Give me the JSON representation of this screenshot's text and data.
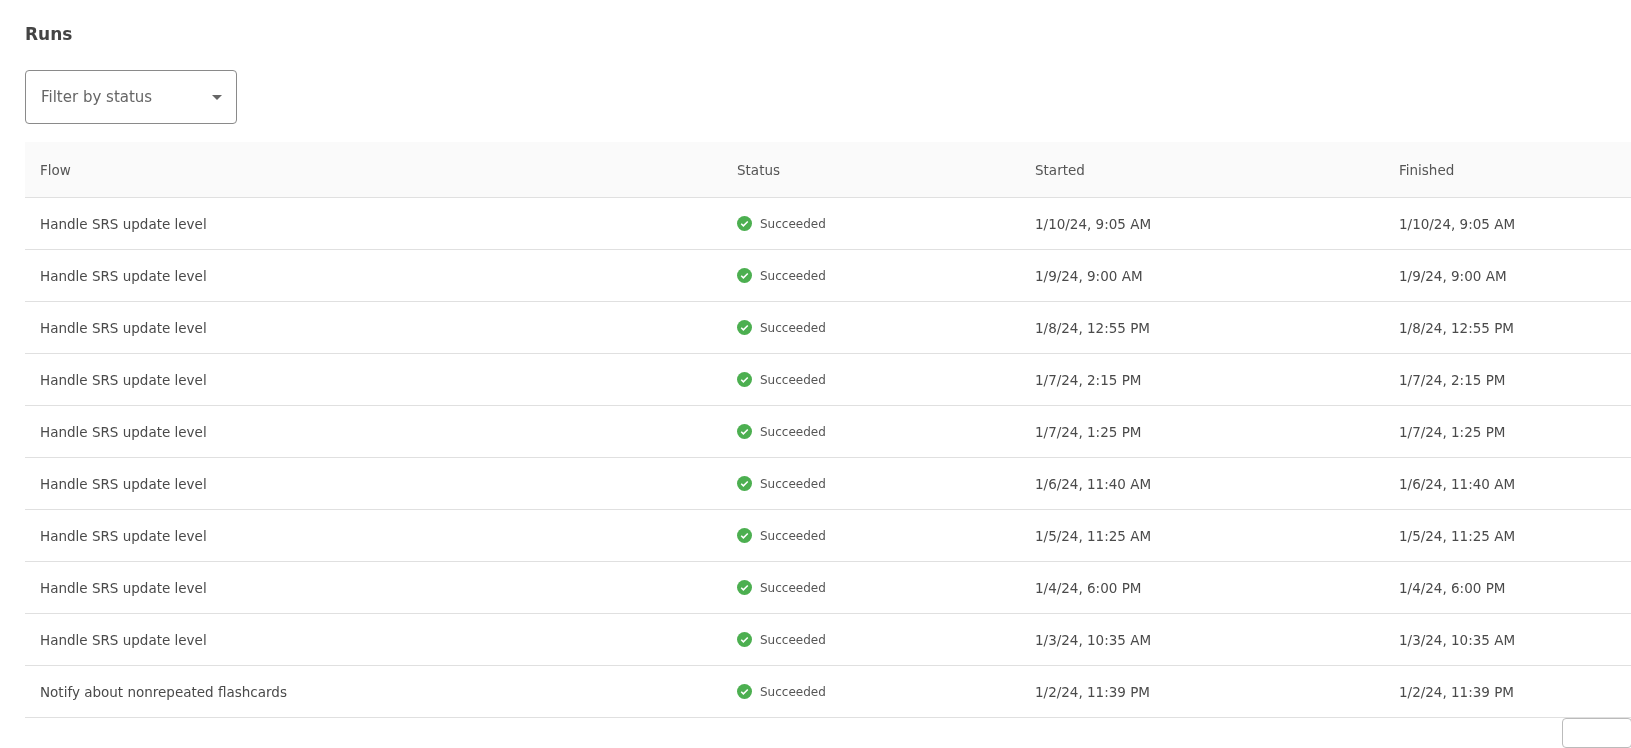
{
  "title": "Runs",
  "filter": {
    "placeholder": "Filter by status"
  },
  "table": {
    "columns": [
      "Flow",
      "Status",
      "Started",
      "Finished"
    ],
    "rows": [
      {
        "flow": "Handle SRS update level",
        "status": {
          "kind": "succeeded",
          "label": "Succeeded"
        },
        "started": "1/10/24, 9:05 AM",
        "finished": "1/10/24, 9:05 AM"
      },
      {
        "flow": "Handle SRS update level",
        "status": {
          "kind": "succeeded",
          "label": "Succeeded"
        },
        "started": "1/9/24, 9:00 AM",
        "finished": "1/9/24, 9:00 AM"
      },
      {
        "flow": "Handle SRS update level",
        "status": {
          "kind": "succeeded",
          "label": "Succeeded"
        },
        "started": "1/8/24, 12:55 PM",
        "finished": "1/8/24, 12:55 PM"
      },
      {
        "flow": "Handle SRS update level",
        "status": {
          "kind": "succeeded",
          "label": "Succeeded"
        },
        "started": "1/7/24, 2:15 PM",
        "finished": "1/7/24, 2:15 PM"
      },
      {
        "flow": "Handle SRS update level",
        "status": {
          "kind": "succeeded",
          "label": "Succeeded"
        },
        "started": "1/7/24, 1:25 PM",
        "finished": "1/7/24, 1:25 PM"
      },
      {
        "flow": "Handle SRS update level",
        "status": {
          "kind": "succeeded",
          "label": "Succeeded"
        },
        "started": "1/6/24, 11:40 AM",
        "finished": "1/6/24, 11:40 AM"
      },
      {
        "flow": "Handle SRS update level",
        "status": {
          "kind": "succeeded",
          "label": "Succeeded"
        },
        "started": "1/5/24, 11:25 AM",
        "finished": "1/5/24, 11:25 AM"
      },
      {
        "flow": "Handle SRS update level",
        "status": {
          "kind": "succeeded",
          "label": "Succeeded"
        },
        "started": "1/4/24, 6:00 PM",
        "finished": "1/4/24, 6:00 PM"
      },
      {
        "flow": "Handle SRS update level",
        "status": {
          "kind": "succeeded",
          "label": "Succeeded"
        },
        "started": "1/3/24, 10:35 AM",
        "finished": "1/3/24, 10:35 AM"
      },
      {
        "flow": "Notify about nonrepeated flashcards",
        "status": {
          "kind": "succeeded",
          "label": "Succeeded"
        },
        "started": "1/2/24, 11:39 PM",
        "finished": "1/2/24, 11:39 PM"
      }
    ]
  }
}
